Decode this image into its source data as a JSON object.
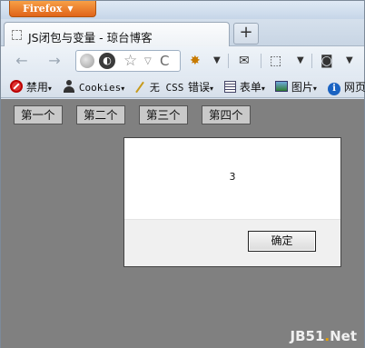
{
  "browser": {
    "menu_button": "Firefox",
    "tab_title": "JS闭包与变量 - 琼台博客",
    "new_tab": "+"
  },
  "nav": {
    "back": "←",
    "forward": "→",
    "url_identity": "◐",
    "star": "☆",
    "dropdown": "▽",
    "reload": "C"
  },
  "bookmarks": [
    {
      "label": "禁用"
    },
    {
      "label": "Cookies"
    },
    {
      "label": "无 CSS"
    },
    {
      "label": "错误"
    },
    {
      "label": "表单"
    },
    {
      "label": "图片"
    },
    {
      "label": "网页"
    }
  ],
  "page": {
    "buttons": [
      "第一个",
      "第二个",
      "第三个",
      "第四个"
    ]
  },
  "dialog": {
    "message": "3",
    "ok_label": "确定"
  },
  "watermark": {
    "part1": "JB51",
    "part2": ".",
    "part3": "Net"
  }
}
